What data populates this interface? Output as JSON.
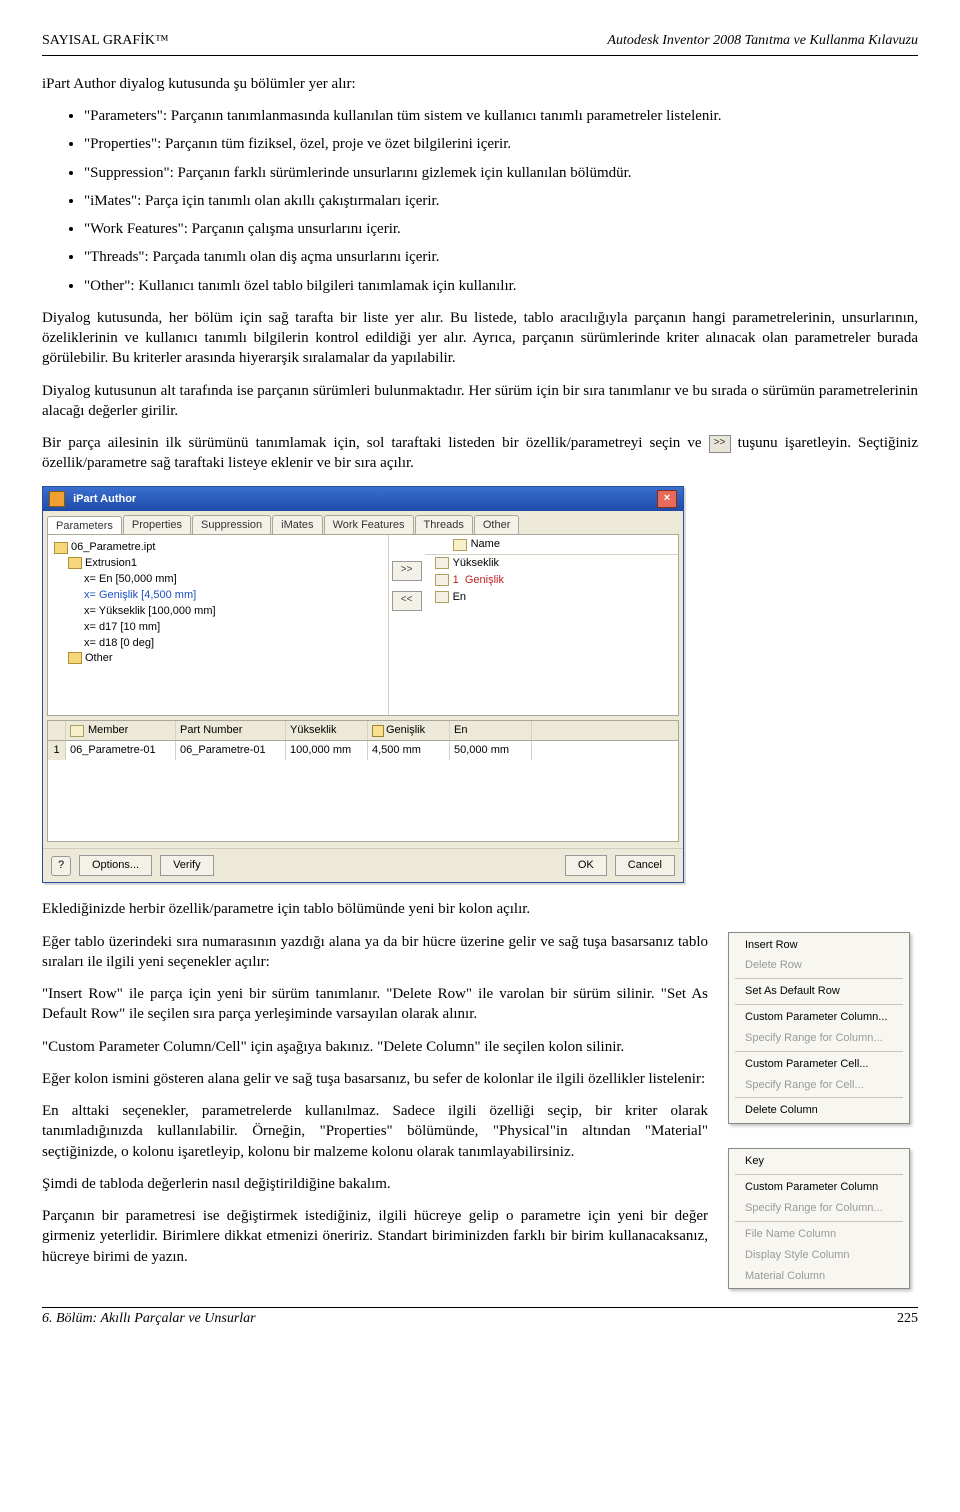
{
  "header": {
    "left": "SAYISAL GRAFİK™",
    "right": "Autodesk Inventor 2008 Tanıtma ve Kullanma Kılavuzu"
  },
  "intro": "iPart Author diyalog kutusunda şu bölümler yer alır:",
  "bullets": [
    "\"Parameters\": Parçanın tanımlanmasında kullanılan tüm sistem ve kullanıcı tanımlı parametreler listelenir.",
    "\"Properties\": Parçanın tüm fiziksel, özel, proje ve özet bilgilerini içerir.",
    "\"Suppression\": Parçanın farklı sürümlerinde unsurlarını gizlemek için kullanılan bölümdür.",
    "\"iMates\": Parça için tanımlı olan akıllı çakıştırmaları içerir.",
    "\"Work Features\": Parçanın çalışma unsurlarını içerir.",
    "\"Threads\": Parçada tanımlı olan diş açma unsurlarını içerir.",
    "\"Other\": Kullanıcı tanımlı özel tablo bilgileri tanımlamak için kullanılır."
  ],
  "p1": "Diyalog kutusunda, her bölüm için sağ tarafta bir liste yer alır. Bu listede, tablo aracılığıyla parçanın hangi parametrelerinin, unsurlarının, özeliklerinin ve kullanıcı tanımlı bilgilerin kontrol edildiği yer alır. Ayrıca, parçanın sürümlerinde kriter alınacak olan parametreler burada görülebilir. Bu kriterler arasında hiyerarşik sıralamalar da yapılabilir.",
  "p2": "Diyalog kutusunun alt tarafında ise parçanın sürümleri bulunmaktadır. Her sürüm için bir sıra tanımlanır ve bu sırada o sürümün parametrelerinin alacağı değerler girilir.",
  "p3a": "Bir parça ailesinin ilk sürümünü tanımlamak için, sol taraftaki listeden bir özellik/parametreyi seçin ve ",
  "p3b": " tuşunu işaretleyin. Seçtiğiniz özellik/parametre sağ taraftaki listeye eklenir ve bir sıra açılır.",
  "dialog": {
    "title": "iPart Author",
    "tabs": [
      "Parameters",
      "Properties",
      "Suppression",
      "iMates",
      "Work Features",
      "Threads",
      "Other"
    ],
    "tree": {
      "root": "06_Parametre.ipt",
      "node1": "Extrusion1",
      "l1": "x= En [50,000 mm]",
      "l2": "x= Genişlik [4,500 mm]",
      "l3": "x= Yükseklik [100,000 mm]",
      "l4": "x= d17 [10 mm]",
      "l5": "x= d18 [0 deg]",
      "other": "Other"
    },
    "nameHeader": "Name",
    "nameList": {
      "n1": "Yükseklik",
      "n2": "Genişlik",
      "n2num": "1",
      "n3": "En"
    },
    "btns": {
      "fwd": ">>",
      "back": "<<"
    },
    "gridHead": {
      "num": "",
      "c1": "Member",
      "c2": "Part Number",
      "c3": "Yükseklik",
      "c4": "Genişlik",
      "c5": "En"
    },
    "gridRow": {
      "num": "1",
      "c1": "06_Parametre-01",
      "c2": "06_Parametre-01",
      "c3": "100,000 mm",
      "c4": "4,500 mm",
      "c5": "50,000 mm"
    },
    "footer": {
      "options": "Options...",
      "verify": "Verify",
      "ok": "OK",
      "cancel": "Cancel"
    }
  },
  "p4": "Eklediğinizde herbir özellik/parametre için tablo bölümünde yeni bir kolon açılır.",
  "p5": "Eğer tablo üzerindeki sıra numarasının yazdığı alana ya da bir hücre üzerine gelir ve sağ tuşa basarsanız tablo sıraları ile ilgili yeni seçenekler açılır:",
  "p6": "\"Insert Row\" ile parça için yeni bir sürüm tanımlanır. \"Delete Row\" ile varolan bir sürüm silinir. \"Set As Default Row\" ile seçilen sıra parça yerleşiminde varsayılan olarak alınır.",
  "p7": "\"Custom Parameter Column/Cell\" için aşağıya bakınız. \"Delete Column\" ile seçilen kolon silinir.",
  "p8": "Eğer kolon ismini gösteren alana gelir ve sağ tuşa basarsanız, bu sefer de kolonlar ile ilgili özellikler listelenir:",
  "p9": "En alttaki seçenekler, parametrelerde kullanılmaz. Sadece ilgili özelliği seçip, bir kriter olarak tanımladığınızda kullanılabilir. Örneğin, \"Properties\" bölümünde, \"Physical\"in altından \"Material\" seçtiğinizde, o kolonu işaretleyip, kolonu bir malzeme kolonu olarak tanımlayabilirsiniz.",
  "p10": "Şimdi de tabloda değerlerin nasıl değiştirildiğine bakalım.",
  "p11": "Parçanın bir parametresi ise değiştirmek istediğiniz, ilgili hücreye gelip o parametre için yeni bir değer girmeniz yeterlidir. Birimlere dikkat etmenizi öneririz. Standart biriminizden farklı bir birim kullanacaksanız, hücreye birimi de yazın.",
  "ctx1": {
    "i1": "Insert Row",
    "i2": "Delete Row",
    "i3": "Set As Default Row",
    "i4": "Custom Parameter Column...",
    "i5": "Specify Range for Column...",
    "i6": "Custom Parameter Cell...",
    "i7": "Specify Range for Cell...",
    "i8": "Delete Column"
  },
  "ctx2": {
    "i1": "Key",
    "i2": "Custom Parameter Column",
    "i3": "Specify Range for Column...",
    "i4": "File Name Column",
    "i5": "Display Style Column",
    "i6": "Material Column"
  },
  "footer": {
    "left": "6. Bölüm: Akıllı Parçalar ve Unsurlar",
    "right": "225"
  },
  "icon_glyph": ">>"
}
